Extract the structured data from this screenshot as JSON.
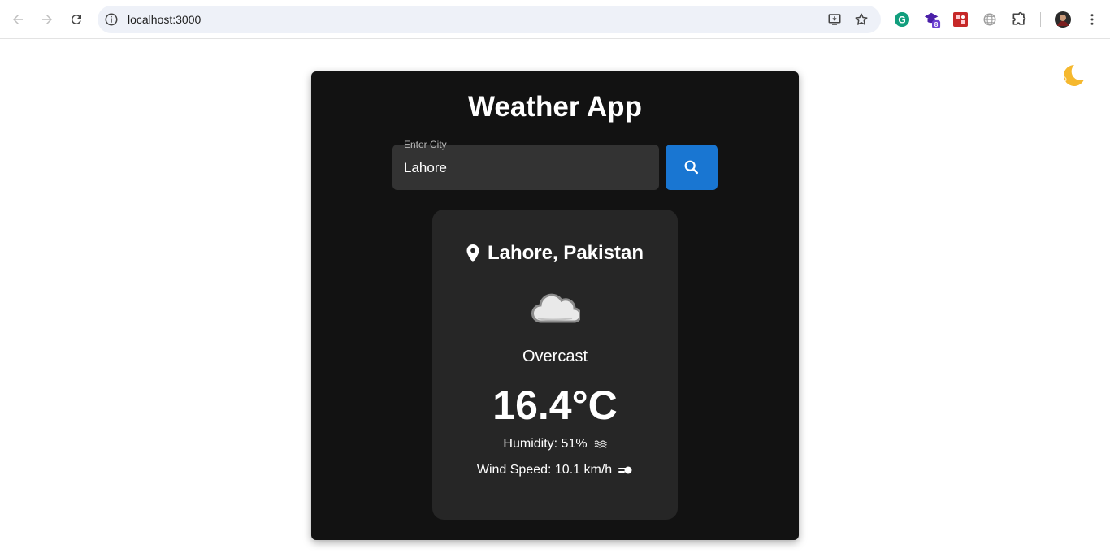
{
  "browser": {
    "url": "localhost:3000",
    "extension_badge": "8"
  },
  "page": {
    "title": "Weather App",
    "theme_toggle_icon": "moon-icon",
    "search": {
      "label": "Enter City",
      "value": "Lahore",
      "button_icon": "search-icon"
    },
    "weather": {
      "location": "Lahore, Pakistan",
      "condition": "Overcast",
      "icon": "cloud-icon",
      "temperature": "16.4°C",
      "humidity": "Humidity: 51%",
      "wind_speed": "Wind Speed: 10.1 km/h"
    },
    "colors": {
      "card_bg": "#121212",
      "inner_card_bg": "#262626",
      "accent_button": "#1976d2",
      "moon": "#f5b82e"
    }
  }
}
